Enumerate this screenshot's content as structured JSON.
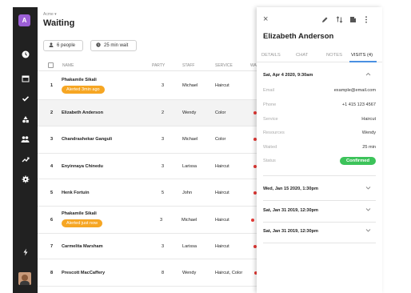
{
  "app_badge": "A",
  "sidebar": {
    "icons": [
      "clock-icon",
      "calendar-icon",
      "check-icon",
      "shapes-icon",
      "people-icon",
      "trend-icon",
      "gear-icon",
      "lightning-icon"
    ]
  },
  "header": {
    "account": "Acme",
    "title": "Waiting"
  },
  "filters": {
    "people": "6 people",
    "wait": "25 min wait"
  },
  "table": {
    "columns": [
      "NAME",
      "PARTY",
      "STAFF",
      "SERVICE",
      "WA"
    ],
    "rows": [
      {
        "num": "1",
        "name": "Phakamile Sikali",
        "alert": "Alerted 3min ago",
        "party": "3",
        "staff": "Michael",
        "service": "Haircut"
      },
      {
        "num": "2",
        "name": "Elizabeth Anderson",
        "alert": "",
        "party": "2",
        "staff": "Wendy",
        "service": "Color"
      },
      {
        "num": "3",
        "name": "Chandrashekar Ganguli",
        "alert": "",
        "party": "3",
        "staff": "Michael",
        "service": "Color"
      },
      {
        "num": "4",
        "name": "Enyinnaya Chinedu",
        "alert": "",
        "party": "3",
        "staff": "Larissa",
        "service": "Haircut"
      },
      {
        "num": "5",
        "name": "Henk Fortuin",
        "alert": "",
        "party": "5",
        "staff": "John",
        "service": "Haircut"
      },
      {
        "num": "6",
        "name": "Phakamile Sikali",
        "alert": "Alerted just now",
        "party": "3",
        "staff": "Michael",
        "service": "Haircut"
      },
      {
        "num": "7",
        "name": "Carmelita Marsham",
        "alert": "",
        "party": "3",
        "staff": "Larissa",
        "service": "Haircut"
      },
      {
        "num": "8",
        "name": "Prescott MacCaffery",
        "alert": "",
        "party": "8",
        "staff": "Wendy",
        "service": "Haircut, Color"
      }
    ]
  },
  "panel": {
    "name": "Elizabeth Anderson",
    "tabs": [
      "DETAILS",
      "CHAT",
      "NOTES",
      "VISITS (4)"
    ],
    "active_tab": "VISITS (4)",
    "expanded_visit": {
      "date": "Sat, Apr 4 2020, 9:30am",
      "fields": [
        {
          "label": "Email",
          "value": "example@email.com"
        },
        {
          "label": "Phone",
          "value": "+1 415 123 4567"
        },
        {
          "label": "Service",
          "value": "Haircut"
        },
        {
          "label": "Resources",
          "value": "Wendy"
        },
        {
          "label": "Waited",
          "value": "25 min"
        }
      ],
      "status_label": "Status",
      "status": "Confirmed"
    },
    "other_visits": [
      "Wed, Jan 15 2020, 1:30pm",
      "Sat, Jan 31 2019, 12:30pm",
      "Sat, Jan 31 2019, 12:30pm"
    ]
  },
  "colors": {
    "rail": "#212121",
    "accent": "#4a90e2",
    "alert": "#f6a623",
    "confirmed": "#3cc35a",
    "app_badge": "#9c5fd6"
  }
}
